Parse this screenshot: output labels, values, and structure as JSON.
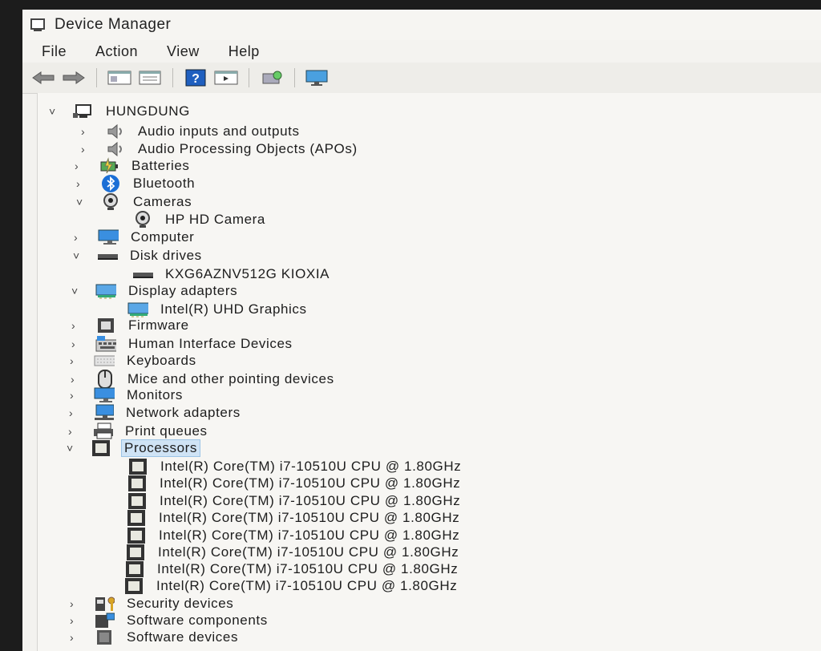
{
  "window": {
    "title": "Device Manager"
  },
  "menu": [
    "File",
    "Action",
    "View",
    "Help"
  ],
  "toolbar": [
    {
      "name": "back-arrow-icon"
    },
    {
      "name": "forward-arrow-icon"
    },
    {
      "name": "show-hide-console-tree-icon"
    },
    {
      "name": "properties-icon"
    },
    {
      "name": "help-icon",
      "glyph": "?"
    },
    {
      "name": "run-action-icon"
    },
    {
      "name": "scan-hardware-changes-icon"
    },
    {
      "name": "display-monitor-icon"
    }
  ],
  "tree": {
    "root": "HUNGDUNG",
    "nodes": [
      {
        "label": "Audio inputs and outputs",
        "expanded": false,
        "icon": "speaker-icon"
      },
      {
        "label": "Audio Processing Objects (APOs)",
        "expanded": false,
        "icon": "speaker-icon"
      },
      {
        "label": "Batteries",
        "expanded": false,
        "icon": "battery-icon"
      },
      {
        "label": "Bluetooth",
        "expanded": false,
        "icon": "bluetooth-icon"
      },
      {
        "label": "Cameras",
        "expanded": true,
        "icon": "webcam-icon",
        "children": [
          {
            "label": "HP HD Camera",
            "icon": "webcam-icon"
          }
        ]
      },
      {
        "label": "Computer",
        "expanded": false,
        "icon": "monitor-icon"
      },
      {
        "label": "Disk drives",
        "expanded": true,
        "icon": "disk-icon",
        "children": [
          {
            "label": "KXG6AZNV512G KIOXIA",
            "icon": "disk-icon"
          }
        ]
      },
      {
        "label": "Display adapters",
        "expanded": true,
        "icon": "display-adapter-icon",
        "children": [
          {
            "label": "Intel(R) UHD Graphics",
            "icon": "display-adapter-icon"
          }
        ]
      },
      {
        "label": "Firmware",
        "expanded": false,
        "icon": "firmware-chip-icon"
      },
      {
        "label": "Human Interface Devices",
        "expanded": false,
        "icon": "hid-keyboard-icon"
      },
      {
        "label": "Keyboards",
        "expanded": false,
        "icon": "keyboard-icon"
      },
      {
        "label": "Mice and other pointing devices",
        "expanded": false,
        "icon": "mouse-icon"
      },
      {
        "label": "Monitors",
        "expanded": false,
        "icon": "monitor-icon"
      },
      {
        "label": "Network adapters",
        "expanded": false,
        "icon": "network-icon"
      },
      {
        "label": "Print queues",
        "expanded": false,
        "icon": "printer-icon"
      },
      {
        "label": "Processors",
        "expanded": true,
        "selected": true,
        "icon": "processor-icon",
        "children": [
          {
            "label": "Intel(R) Core(TM) i7-10510U CPU @ 1.80GHz",
            "icon": "processor-icon"
          },
          {
            "label": "Intel(R) Core(TM) i7-10510U CPU @ 1.80GHz",
            "icon": "processor-icon"
          },
          {
            "label": "Intel(R) Core(TM) i7-10510U CPU @ 1.80GHz",
            "icon": "processor-icon"
          },
          {
            "label": "Intel(R) Core(TM) i7-10510U CPU @ 1.80GHz",
            "icon": "processor-icon"
          },
          {
            "label": "Intel(R) Core(TM) i7-10510U CPU @ 1.80GHz",
            "icon": "processor-icon"
          },
          {
            "label": "Intel(R) Core(TM) i7-10510U CPU @ 1.80GHz",
            "icon": "processor-icon"
          },
          {
            "label": "Intel(R) Core(TM) i7-10510U CPU @ 1.80GHz",
            "icon": "processor-icon"
          },
          {
            "label": "Intel(R) Core(TM) i7-10510U CPU @ 1.80GHz",
            "icon": "processor-icon"
          }
        ]
      },
      {
        "label": "Security devices",
        "expanded": false,
        "icon": "security-key-icon"
      },
      {
        "label": "Software components",
        "expanded": false,
        "icon": "software-component-icon"
      },
      {
        "label": "Software devices",
        "expanded": false,
        "icon": "software-device-icon"
      }
    ]
  },
  "colors": {
    "selection": "#cfe3f5",
    "selection_border": "#9cc4e6",
    "help_blue": "#1f5fbf",
    "bluetooth": "#1b6fd6"
  }
}
